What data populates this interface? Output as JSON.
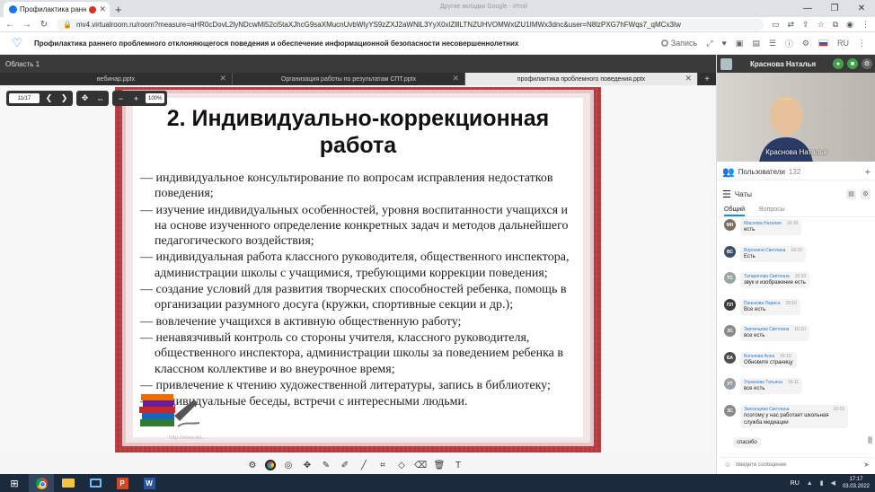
{
  "browser": {
    "tab_title": "Профилактика раннего пр",
    "ghost_title": "Другие вкладки Google - Итой",
    "url": "mv4.virtualroom.ru/room?measure=aHR0cDovL2lyNDcwMi52ci5taXJhcG9saXMucnUvbWlyYS9zZXJ2aWNlL3YyX0xlZlllLTNZUHVOMWxtZU1IMWx3dnc&user=N8lzPXG7hFWqs7_qMCx3Iw"
  },
  "app": {
    "title": "Профилактика раннего проблемного отклоняющегося поведения и обеспечение информационной безопасности несовершеннолетних",
    "record_label": "Запись",
    "lang": "RU"
  },
  "stage": {
    "area_label": "Область 1",
    "doc_tabs": [
      {
        "label": "вебинар.pptx",
        "active": false
      },
      {
        "label": "Организация работы по результатам СПТ.pptx",
        "active": false
      },
      {
        "label": "профилактика проблемного поведения.pptx",
        "active": true
      }
    ],
    "page_indicator": "11/17",
    "zoom": "100%"
  },
  "slide": {
    "title_line1": "2. Индивидуально-коррекционная",
    "title_line2": "работа",
    "items": [
      "индивидуальное консультирование по вопросам исправления недостатков поведения;",
      "изучение индивидуальных особенностей, уровня воспитанности учащихся и на основе изученного определение конкретных задач и методов дальнейшего педагогического воздействия;",
      "индивидуальная работа классного руководителя, общественного инспектора, администрации школы с учащимися, требующими коррекции поведения;",
      "создание условий для развития творческих способностей ребенка, помощь в организации разумного досуга (кружки, спортивные секции и др.);",
      "вовлечение учащихся в активную общественную работу;",
      "ненавязчивый контроль со стороны учителя, классного руководителя, общественного инспектора, администрации школы за поведением ребенка в классном коллективе и во внеурочное время;",
      "привлечение к чтению художественной литературы, запись в библиотеку;",
      "индивидуальные беседы, встречи с интересными людьми."
    ],
    "watermark": "http://www.ed..."
  },
  "presenter": {
    "name": "Краснова Наталья",
    "video_caption": "Краснова Наталья"
  },
  "users": {
    "label": "Пользователи",
    "count": "132"
  },
  "chat": {
    "label": "Чаты",
    "tabs": [
      "Общий",
      "Вопросы"
    ],
    "input_placeholder": "Введите сообщение",
    "messages": [
      {
        "initials": "МН",
        "color": "#7b6f63",
        "name": "Маслова Наталия",
        "time": "16:10",
        "text": "есть"
      },
      {
        "initials": "ВС",
        "color": "#3d4f66",
        "name": "Воронина Светлана",
        "time": "16:10",
        "text": "Есть"
      },
      {
        "initials": "ТС",
        "color": "#9aa7a0",
        "name": "Татаринова Светлана",
        "time": "16:10",
        "text": "звук и изображение есть"
      },
      {
        "initials": "ПЛ",
        "color": "#3a3a3a",
        "name": "Панькова Лариса",
        "time": "16:10",
        "text": "Все есть"
      },
      {
        "initials": "ЗС",
        "color": "#8b8a88",
        "name": "Звегинцева Светлана",
        "time": "16:10",
        "text": "все есть"
      },
      {
        "initials": "БА",
        "color": "#4e4e4e",
        "name": "Богачева Анна",
        "time": "16:10",
        "text": "Обновите страницу"
      },
      {
        "initials": "УТ",
        "color": "#9aa0a6",
        "name": "Угрюмова Татьяна",
        "time": "16:11",
        "text": "все есть"
      },
      {
        "initials": "ЗС",
        "color": "#8b8a88",
        "name": "Звегинцева Светлана",
        "time": "16:15",
        "text": "поэтому у нас работает школьная служба медиации"
      },
      {
        "initials": "",
        "color": "",
        "name": "",
        "time": "",
        "text": "спасибо"
      }
    ]
  },
  "taskbar": {
    "lang": "RU",
    "time": "17:17",
    "date": "03.03.2022"
  }
}
